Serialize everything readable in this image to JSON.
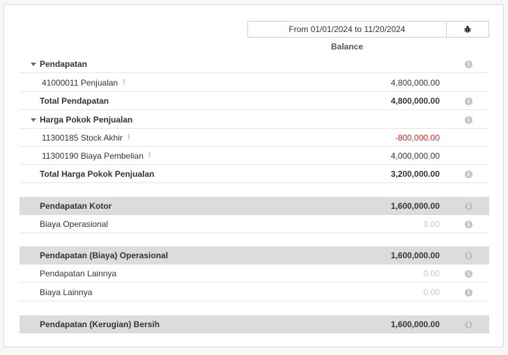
{
  "header": {
    "period": "From 01/01/2024 to 11/20/2024",
    "column": "Balance",
    "bug_icon": "bug-icon"
  },
  "rows": {
    "pendapatan": {
      "label": "Pendapatan",
      "icon": "caret-down-icon"
    },
    "penjualan": {
      "label": "41000011 Penjualan",
      "value": "4,800,000.00"
    },
    "total_pendapatan": {
      "label": "Total Pendapatan",
      "value": "4,800,000.00"
    },
    "hpp": {
      "label": "Harga Pokok Penjualan",
      "icon": "caret-down-icon"
    },
    "stock_akhir": {
      "label": "11300185 Stock Akhir",
      "value": "-800,000.00"
    },
    "biaya_pembelian": {
      "label": "11300190 Biaya Pembelian",
      "value": "4,000,000.00"
    },
    "total_hpp": {
      "label": "Total Harga Pokok Penjualan",
      "value": "3,200,000.00"
    },
    "pendapatan_kotor": {
      "label": "Pendapatan Kotor",
      "value": "1,600,000.00"
    },
    "biaya_operasional": {
      "label": "Biaya Operasional",
      "value": "0.00"
    },
    "pendapatan_operasional": {
      "label": "Pendapatan (Biaya) Operasional",
      "value": "1,600,000.00"
    },
    "pendapatan_lainnya": {
      "label": "Pendapatan Lainnya",
      "value": "0.00"
    },
    "biaya_lainnya": {
      "label": "Biaya Lainnya",
      "value": "0.00"
    },
    "bersih": {
      "label": "Pendapatan (Kerugian) Bersih",
      "value": "1,600,000.00"
    }
  },
  "colors": {
    "negative": "#c62828",
    "band": "#dcdcde",
    "muted": "#c8c8c8"
  },
  "info_glyph": "i",
  "kebab_glyph": "⁝"
}
